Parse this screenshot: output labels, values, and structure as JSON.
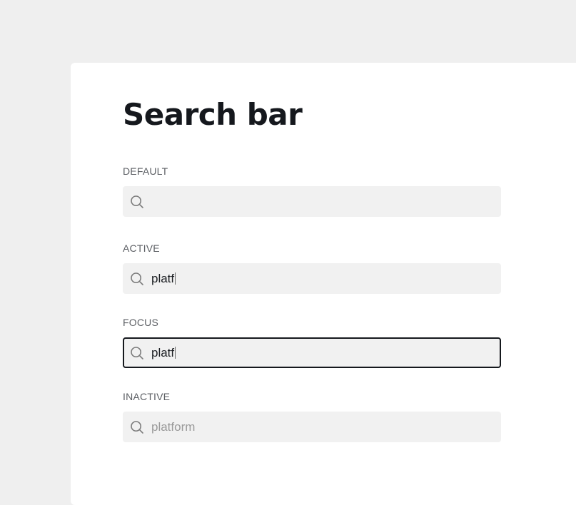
{
  "page": {
    "title": "Search bar"
  },
  "sections": {
    "default": {
      "label": "DEFAULT",
      "value": ""
    },
    "active": {
      "label": "ACTIVE",
      "value": "platf"
    },
    "focus": {
      "label": "FOCUS",
      "value": "platf"
    },
    "inactive": {
      "label": "INACTIVE",
      "value": "platform"
    }
  },
  "icons": {
    "search": "search-icon"
  },
  "colors": {
    "page_background": "#efefef",
    "card_background": "#ffffff",
    "input_background": "#f1f1f1",
    "focus_border": "#15181d",
    "title_text": "#15181d",
    "label_text": "#5c5f64",
    "inactive_text": "#9a9a9a"
  }
}
